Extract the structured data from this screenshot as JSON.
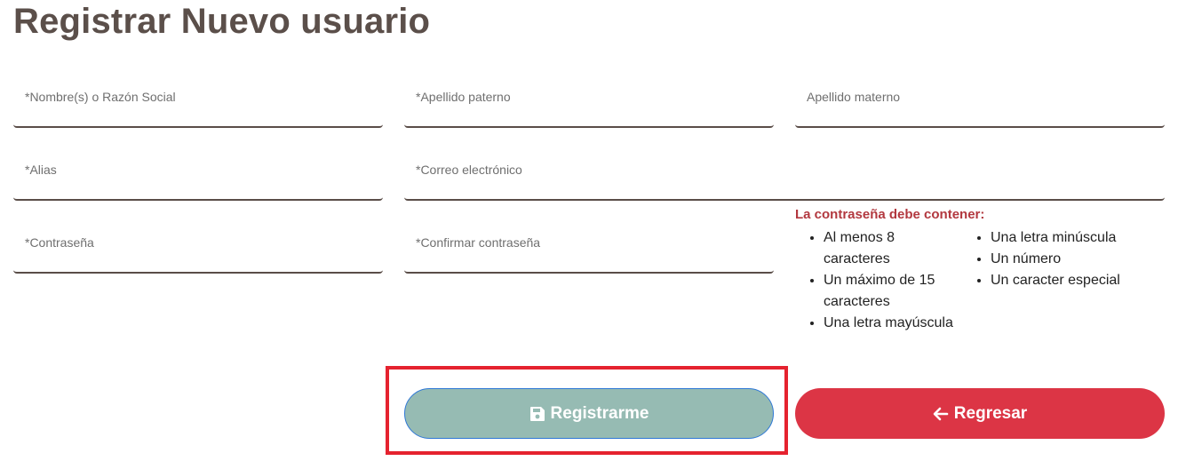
{
  "page": {
    "title": "Registrar Nuevo usuario"
  },
  "form": {
    "nombre_placeholder": "*Nombre(s) o Razón Social",
    "apellido_paterno_placeholder": "*Apellido paterno",
    "apellido_materno_placeholder": "Apellido materno",
    "alias_placeholder": "*Alias",
    "correo_placeholder": "*Correo electrónico",
    "contrasena_placeholder": "*Contraseña",
    "confirmar_placeholder": "*Confirmar contraseña"
  },
  "password_rules": {
    "title": "La contraseña debe contener:",
    "left": [
      "Al menos 8 caracteres",
      "Un máximo de 15 caracteres",
      "Una letra mayúscula"
    ],
    "right": [
      "Una letra minúscula",
      "Un número",
      "Un caracter especial"
    ]
  },
  "actions": {
    "register_label": "Registrarme",
    "back_label": "Regresar",
    "register_icon": "floppy-disk-icon",
    "back_icon": "arrow-left-icon"
  },
  "colors": {
    "title": "#5b4f4a",
    "rules_title": "#b2383f",
    "register_bg": "#96bbb3",
    "back_bg": "#dc3545",
    "highlight": "#e5222f"
  }
}
